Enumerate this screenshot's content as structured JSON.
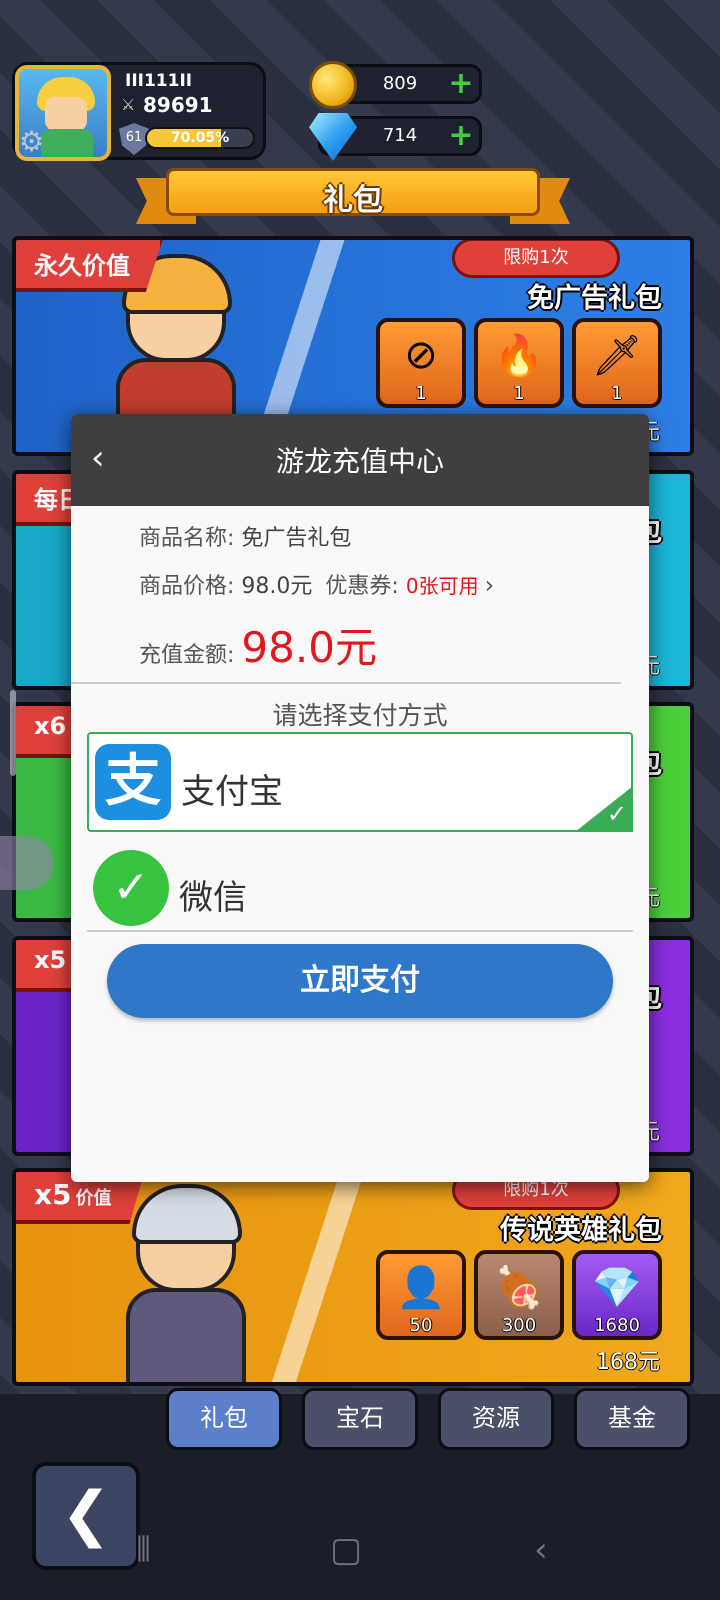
{
  "player": {
    "name": "III111II",
    "power": "89691",
    "level": "61",
    "xp_percent": 70.05,
    "xp_text": "70.05%"
  },
  "currency": {
    "coins": "809",
    "gems": "714"
  },
  "header": {
    "title": "礼包"
  },
  "cards": [
    {
      "tag": "永久价值",
      "limit": "限购1次",
      "name": "免广告礼包",
      "items": [
        "1",
        "1",
        "1"
      ],
      "price": "元"
    },
    {
      "tag": "每日",
      "name": "礼包",
      "price": "元"
    },
    {
      "tag": "x6",
      "name": "包",
      "price": "元"
    },
    {
      "tag": "x5",
      "name": "包",
      "price": "元"
    },
    {
      "tag": "x5",
      "tag_suffix": "价值",
      "limit": "限购1次",
      "name": "传说英雄礼包",
      "items": [
        "50",
        "300",
        "1680"
      ],
      "price": "168元"
    }
  ],
  "dialog": {
    "title": "游龙充值中心",
    "product_label": "商品名称:",
    "product_value": "免广告礼包",
    "price_label": "商品价格:",
    "price_value": "98.0元",
    "coupon_label": "优惠券:",
    "coupon_value": "0张可用",
    "amount_label": "充值金额:",
    "amount_value": "98.0元",
    "choose_text": "请选择支付方式",
    "methods": [
      {
        "label": "支付宝",
        "icon_char": "支",
        "selected": true
      },
      {
        "label": "微信",
        "icon_char": "✓",
        "selected": false
      }
    ],
    "pay_button": "立即支付"
  },
  "tabs": [
    {
      "label": "礼包",
      "active": true
    },
    {
      "label": "宝石",
      "active": false
    },
    {
      "label": "资源",
      "active": false
    },
    {
      "label": "基金",
      "active": false
    }
  ],
  "colors": {
    "accent_red": "#e1171e",
    "alipay_blue": "#1c8fe0",
    "wechat_green": "#37c23f",
    "pay_button": "#2f78c9",
    "selected_border": "#3aab56"
  }
}
